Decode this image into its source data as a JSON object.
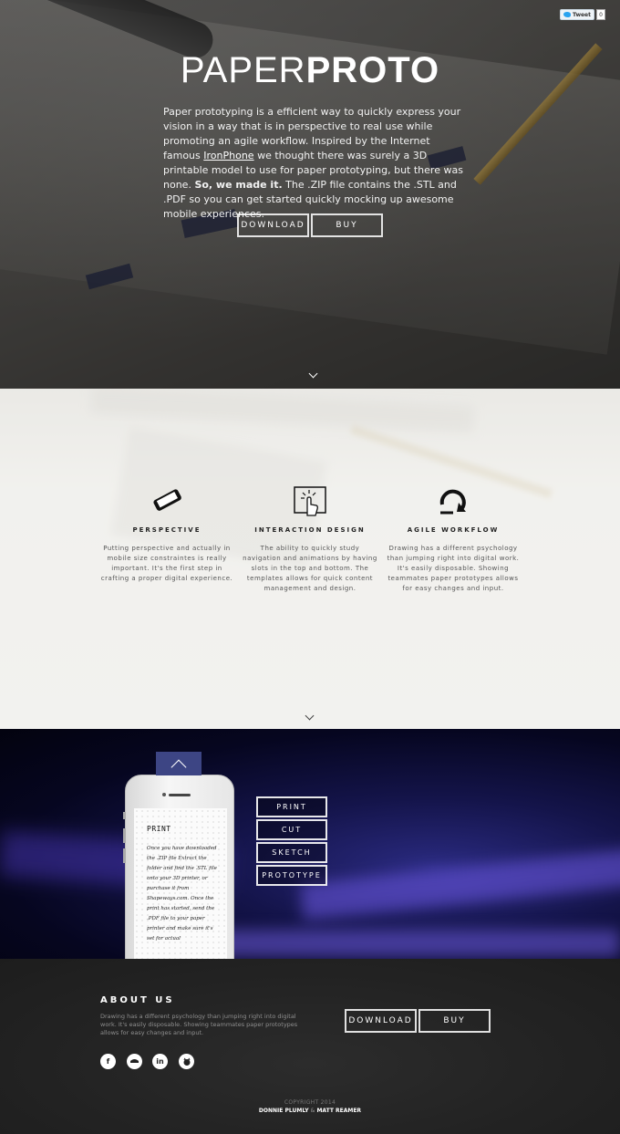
{
  "tweet": {
    "label": "Tweet",
    "count": "0"
  },
  "brand": {
    "light": "PAPER",
    "bold": "PROTO"
  },
  "intro": {
    "text1": "Paper prototyping is a efficient way to quickly express your vision in a way that is in perspective to real use while promoting an agile workflow. Inspired by the Internet famous ",
    "link": "IronPhone",
    "text2": " we thought there was surely a 3D printable model to use for paper prototyping, but there was none. ",
    "bold": "So, we made it.",
    "text3": " The .ZIP file contains the .STL and .PDF so you can get started quickly mocking up awesome mobile experiences."
  },
  "hero_buttons": {
    "download": "DOWNLOAD",
    "buy": "BUY"
  },
  "features": [
    {
      "icon": "phone-perspective-icon",
      "title": "PERSPECTIVE",
      "text": "Putting perspective and actually in mobile size constraintes is really important. It's the first step in crafting a proper digital experience."
    },
    {
      "icon": "touch-screen-icon",
      "title": "INTERACTION DESIGN",
      "text": "The ability to quickly study navigation and animations by having slots in the top and bottom. The templates allows for quick content management and design."
    },
    {
      "icon": "cycle-arrow-icon",
      "title": "AGILE WORKFLOW",
      "text": "Drawing has a different psychology than jumping right into digital work. It's easily disposable. Showing teammates paper prototypes allows for easy changes and input."
    }
  ],
  "phone_screen": {
    "heading": "PRINT",
    "text": "Once you have downloaded the .ZIP file Extract the folder and find the .STL file onto your 3D printer, or purchase it from Shapeways.com. Once the print has started, send the .PDF file to your paper printer and make sure it's set for actual"
  },
  "steps": [
    "PRINT",
    "CUT",
    "SKETCH",
    "PROTOTYPE"
  ],
  "footer": {
    "heading": "ABOUT US",
    "about": "Drawing has a different psychology than jumping right into digital work. It's easily disposable. Showing teammates paper prototypes allows for easy changes and input.",
    "download": "DOWNLOAD",
    "buy": "BUY",
    "social": [
      {
        "icon": "facebook-icon",
        "glyph": "f"
      },
      {
        "icon": "dribbble-icon",
        "glyph": ""
      },
      {
        "icon": "linkedin-icon",
        "glyph": "in"
      },
      {
        "icon": "github-icon",
        "glyph": ""
      }
    ],
    "copyright": "COPYRIGHT 2014",
    "author1": "DONNIE PLUMLY",
    "amp": "&",
    "author2": "MATT REAMER"
  }
}
